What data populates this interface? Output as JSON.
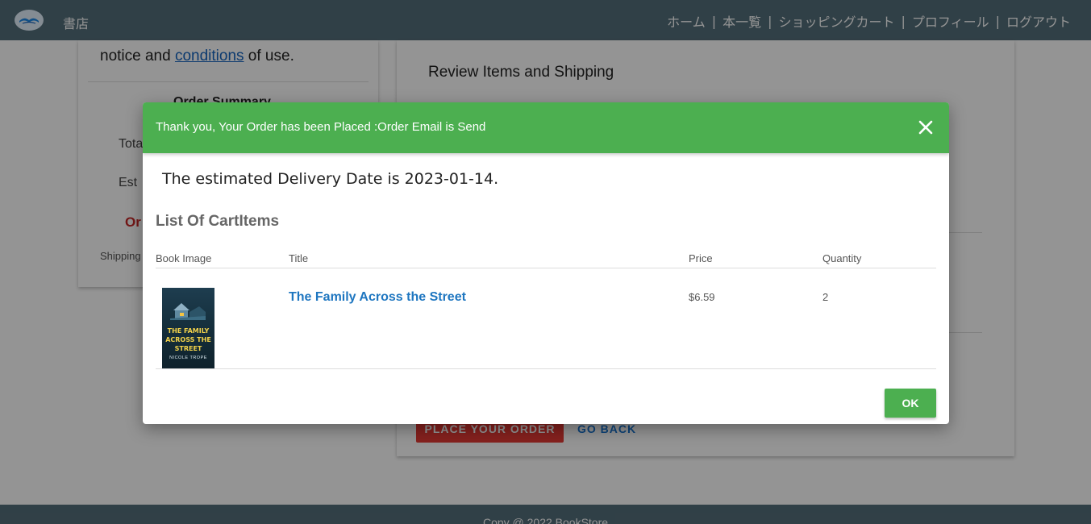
{
  "nav": {
    "brand": "書店",
    "links": [
      "ホーム",
      "本一覧",
      "ショッピングカート",
      "プロフィール",
      "ログアウト"
    ],
    "separator": "|"
  },
  "background": {
    "notice_prefix": "notice and ",
    "notice_link": "conditions",
    "notice_suffix": " of use.",
    "order_summary": "Order Summary",
    "row_total": "Tota",
    "row_est": "Est",
    "row_red": "Or",
    "shipping_small": "Shipping",
    "review_title": "Review Items and Shipping",
    "place_order": "PLACE YOUR ORDER",
    "go_back": "GO BACK",
    "footer": "Copy @ 2022 BookStore"
  },
  "modal": {
    "header_text": "Thank you, Your Order has been Placed :Order Email is Send",
    "header_color": "#4caf50",
    "delivery_text": "The estimated Delivery Date is 2023-01-14.",
    "list_heading": "List Of CartItems",
    "columns": [
      "Book Image",
      "Title",
      "Price",
      "Quantity"
    ],
    "items": [
      {
        "cover_title": "THE FAMILY ACROSS THE STREET",
        "cover_author": "NICOLE TROPE",
        "title": "The Family Across the Street",
        "price": "$6.59",
        "quantity": "2"
      }
    ],
    "ok_label": "OK"
  },
  "icons": {
    "logo": "book-logo-icon",
    "close": "close-icon"
  }
}
